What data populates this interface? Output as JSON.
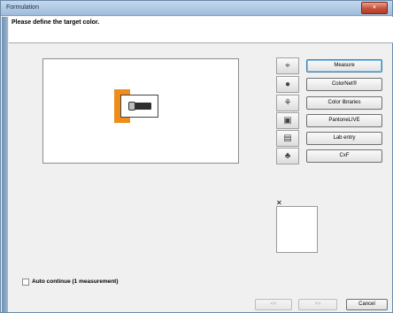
{
  "window": {
    "title": "Formulation",
    "close_label": "Close"
  },
  "header": {
    "prompt": "Please define the target color."
  },
  "sources": [
    {
      "glyph": "⌖",
      "icon": "measure-icon",
      "label": "Measure"
    },
    {
      "glyph": "●",
      "icon": "colornet-icon",
      "label": "ColorNet®"
    },
    {
      "glyph": "⚘",
      "icon": "color-libraries-icon",
      "label": "Color libraries"
    },
    {
      "glyph": "▣",
      "icon": "pantonelive-icon",
      "label": "PantoneLIVE"
    },
    {
      "glyph": "▤",
      "icon": "lab-entry-icon",
      "label": "Lab entry"
    },
    {
      "glyph": "♣",
      "icon": "cxf-icon",
      "label": "CxF"
    }
  ],
  "swatch": {
    "close_glyph": "✕",
    "color": "#ffffff"
  },
  "auto_continue": {
    "label": "Auto continue (1 measurement)",
    "checked": false
  },
  "footer": {
    "back_label": "<<",
    "next_label": ">>",
    "cancel_label": "Cancel"
  }
}
